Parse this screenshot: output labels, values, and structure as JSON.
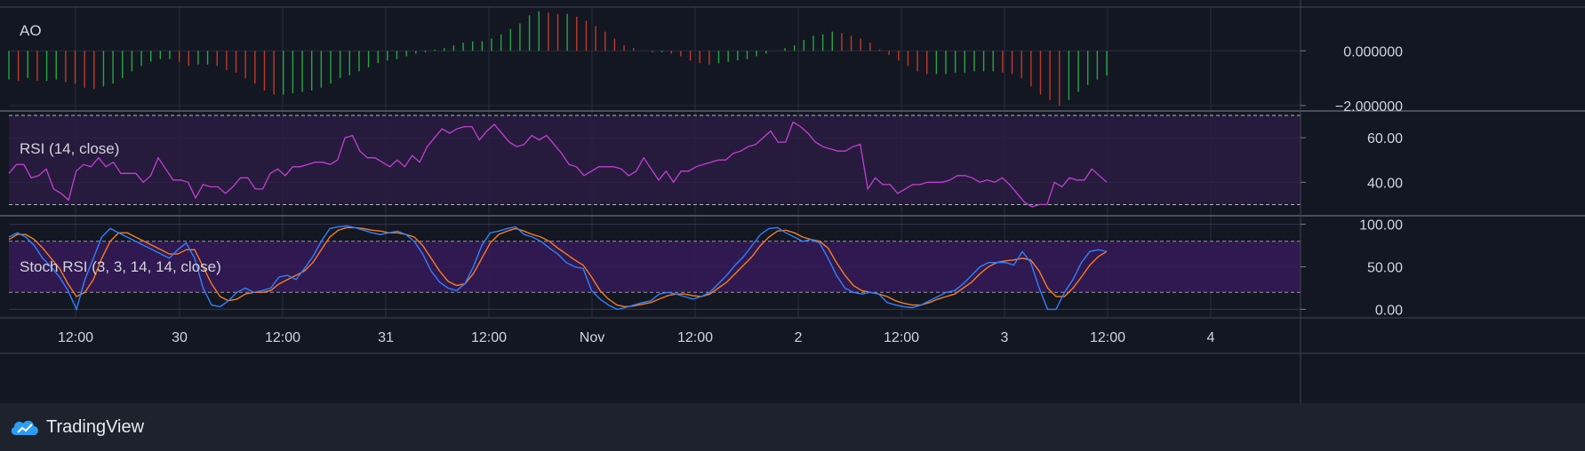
{
  "panes": {
    "ao": {
      "label": "AO"
    },
    "rsi": {
      "label": "RSI (14, close)"
    },
    "stoch": {
      "label": "Stoch RSI (3, 3, 14, 14, close)"
    }
  },
  "footer": {
    "brand": "TradingView"
  },
  "colors": {
    "background": "#131722",
    "ao_up": "#26a641",
    "ao_down": "#c0392b",
    "rsi_line": "#c23fd1",
    "rsi_band": "#2a1c42",
    "stoch_k": "#2f80ff",
    "stoch_d": "#f57c20",
    "stoch_band": "#341a55"
  },
  "chart_data": [
    {
      "type": "bar",
      "title": "AO",
      "x_ticks": [
        "12:00",
        "30",
        "12:00",
        "31",
        "12:00",
        "Nov",
        "12:00",
        "2",
        "12:00",
        "3",
        "12:00",
        "4"
      ],
      "y_ticks": [
        "0.000000",
        "−2.000000"
      ],
      "ylim": [
        -2.2,
        1.6
      ],
      "values": [
        -1.05,
        -1.1,
        -1.0,
        -1.1,
        -1.1,
        -1.05,
        -1.15,
        -1.2,
        -1.35,
        -1.4,
        -1.3,
        -1.2,
        -1.0,
        -0.75,
        -0.55,
        -0.4,
        -0.3,
        -0.3,
        -0.4,
        -0.55,
        -0.5,
        -0.5,
        -0.55,
        -0.7,
        -0.8,
        -1.0,
        -1.2,
        -1.45,
        -1.6,
        -1.6,
        -1.55,
        -1.5,
        -1.45,
        -1.35,
        -1.2,
        -1.0,
        -0.9,
        -0.75,
        -0.6,
        -0.45,
        -0.35,
        -0.3,
        -0.2,
        -0.1,
        -0.05,
        0.05,
        0.1,
        0.2,
        0.3,
        0.35,
        0.35,
        0.45,
        0.6,
        0.8,
        1.0,
        1.3,
        1.45,
        1.4,
        1.35,
        1.35,
        1.25,
        1.1,
        0.9,
        0.7,
        0.45,
        0.2,
        0.1,
        0.0,
        -0.05,
        -0.05,
        -0.1,
        -0.2,
        -0.35,
        -0.45,
        -0.5,
        -0.45,
        -0.4,
        -0.35,
        -0.3,
        -0.2,
        -0.1,
        0.0,
        0.1,
        0.2,
        0.4,
        0.55,
        0.6,
        0.7,
        0.65,
        0.55,
        0.45,
        0.3,
        0.05,
        -0.15,
        -0.35,
        -0.55,
        -0.75,
        -0.85,
        -0.85,
        -0.85,
        -0.8,
        -0.8,
        -0.75,
        -0.75,
        -0.75,
        -0.8,
        -0.85,
        -1.0,
        -1.3,
        -1.6,
        -1.8,
        -2.0,
        -1.8,
        -1.5,
        -1.25,
        -1.05,
        -0.9
      ]
    },
    {
      "type": "line",
      "title": "RSI (14, close)",
      "y_ticks": [
        "60.00",
        "40.00"
      ],
      "ylim": [
        25,
        72
      ],
      "band": [
        30,
        70
      ],
      "values": [
        44,
        48,
        48,
        42,
        43,
        46,
        37,
        35,
        32,
        45,
        48,
        47,
        51,
        47,
        49,
        44,
        44,
        44,
        40,
        43,
        51,
        46,
        41,
        41,
        40,
        33,
        39,
        38,
        38,
        35,
        38,
        42,
        42,
        37,
        37,
        44,
        46,
        43,
        47,
        47,
        48,
        49,
        49,
        48,
        50,
        60,
        61,
        54,
        51,
        51,
        49,
        47,
        50,
        47,
        52,
        49,
        56,
        60,
        64,
        62,
        64,
        65,
        65,
        59,
        63,
        66,
        62,
        58,
        56,
        57,
        61,
        59,
        61,
        57,
        53,
        48,
        47,
        43,
        45,
        47,
        47,
        47,
        46,
        43,
        45,
        51,
        46,
        41,
        45,
        40,
        45,
        45,
        47,
        48,
        49,
        50,
        50,
        53,
        54,
        56,
        57,
        60,
        63,
        58,
        58,
        67,
        65,
        62,
        58,
        56,
        55,
        54,
        54,
        56,
        57,
        37,
        42,
        39,
        39,
        35,
        37,
        39,
        39,
        40,
        40,
        40,
        41,
        43,
        43,
        42,
        40,
        41,
        40,
        42,
        39,
        35,
        31,
        29,
        30,
        30,
        40,
        38,
        42,
        41,
        41,
        46,
        43,
        40
      ]
    },
    {
      "type": "line",
      "title": "Stoch RSI (3, 3, 14, 14, close)",
      "y_ticks": [
        "100.00",
        "50.00",
        "0.00"
      ],
      "ylim": [
        -10,
        110
      ],
      "band": [
        20,
        80
      ],
      "series": [
        {
          "values": [
            85,
            90,
            85,
            75,
            60,
            50,
            38,
            22,
            0,
            35,
            60,
            85,
            95,
            90,
            85,
            80,
            75,
            70,
            65,
            60,
            70,
            78,
            60,
            25,
            5,
            3,
            10,
            20,
            25,
            20,
            22,
            25,
            38,
            40,
            35,
            48,
            62,
            80,
            95,
            97,
            98,
            96,
            93,
            90,
            88,
            90,
            92,
            88,
            80,
            65,
            45,
            32,
            25,
            22,
            30,
            50,
            75,
            90,
            92,
            95,
            97,
            88,
            85,
            80,
            72,
            65,
            55,
            50,
            48,
            22,
            12,
            5,
            0,
            2,
            5,
            8,
            10,
            18,
            20,
            18,
            15,
            12,
            15,
            20,
            30,
            40,
            52,
            62,
            75,
            88,
            95,
            96,
            90,
            85,
            80,
            82,
            78,
            60,
            40,
            25,
            20,
            18,
            20,
            18,
            8,
            5,
            3,
            2,
            5,
            10,
            15,
            20,
            22,
            30,
            40,
            50,
            55,
            55,
            55,
            52,
            68,
            55,
            25,
            0,
            0,
            20,
            35,
            55,
            68,
            70,
            68
          ]
        },
        {
          "values": [
            82,
            88,
            88,
            82,
            72,
            60,
            48,
            30,
            15,
            20,
            35,
            60,
            80,
            90,
            90,
            85,
            80,
            75,
            70,
            65,
            65,
            70,
            70,
            50,
            30,
            15,
            10,
            12,
            18,
            20,
            20,
            22,
            30,
            35,
            40,
            45,
            55,
            70,
            85,
            93,
            96,
            96,
            95,
            93,
            92,
            90,
            90,
            88,
            85,
            75,
            60,
            45,
            33,
            28,
            30,
            42,
            60,
            78,
            88,
            92,
            95,
            92,
            88,
            85,
            80,
            72,
            65,
            58,
            52,
            38,
            22,
            12,
            5,
            3,
            4,
            6,
            8,
            12,
            16,
            18,
            18,
            16,
            15,
            18,
            25,
            32,
            42,
            52,
            62,
            75,
            85,
            92,
            93,
            90,
            85,
            82,
            80,
            72,
            55,
            40,
            28,
            22,
            20,
            18,
            15,
            10,
            7,
            5,
            5,
            8,
            12,
            15,
            18,
            25,
            32,
            42,
            50,
            55,
            57,
            58,
            60,
            58,
            45,
            25,
            15,
            15,
            25,
            38,
            52,
            62,
            68
          ]
        }
      ]
    }
  ]
}
